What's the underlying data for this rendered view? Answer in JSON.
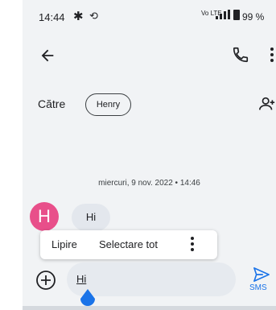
{
  "statusbar": {
    "time": "14:44",
    "gear_icon": "gear-icon",
    "rotate_icon": "screen-rotate-icon",
    "volte_text": "Vo LTE",
    "signal_icon": "signal-icon",
    "battery_icon": "battery-icon",
    "battery_percent": "99 %"
  },
  "toolbar": {
    "back_icon": "back-arrow-icon",
    "call_icon": "phone-icon",
    "menu_icon": "more-vert-icon"
  },
  "recipients": {
    "to_label": "Către",
    "chip_name": "Henry",
    "add_icon": "add-person-icon"
  },
  "conversation": {
    "date_divider": "miercuri, 9 nov. 2022 • 14:46",
    "messages": [
      {
        "avatar_letter": "H",
        "text": "Hi"
      }
    ]
  },
  "context_menu": {
    "paste": "Lipire",
    "select_all": "Selectare tot",
    "more_icon": "more-vert-icon"
  },
  "composer": {
    "add_icon": "add-circle-icon",
    "text": "Hi",
    "send_label": "SMS",
    "send_icon": "send-icon"
  },
  "colors": {
    "accent": "#1a73e8",
    "avatar": "#e84f8a",
    "background": "#f1f3f5"
  }
}
